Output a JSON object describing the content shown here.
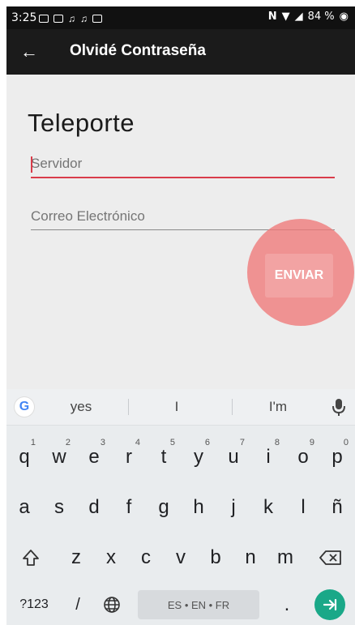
{
  "status": {
    "time": "3:25",
    "battery": "84 %"
  },
  "appbar": {
    "title": "Olvidé Contraseña"
  },
  "content": {
    "brand": "Teleporte",
    "server_placeholder": "Servidor",
    "email_placeholder": "Correo Electrónico",
    "submit_label": "ENVIAR"
  },
  "colors": {
    "accent": "#d93c4a",
    "ripple": "#f07878",
    "enter_key": "#1aa888"
  },
  "keyboard": {
    "suggestions": [
      "yes",
      "I",
      "I'm"
    ],
    "row1": [
      "q",
      "w",
      "e",
      "r",
      "t",
      "y",
      "u",
      "i",
      "o",
      "p"
    ],
    "row1_hints": [
      "1",
      "2",
      "3",
      "4",
      "5",
      "6",
      "7",
      "8",
      "9",
      "0"
    ],
    "row2": [
      "a",
      "s",
      "d",
      "f",
      "g",
      "h",
      "j",
      "k",
      "l",
      "ñ"
    ],
    "row3": [
      "z",
      "x",
      "c",
      "v",
      "b",
      "n",
      "m"
    ],
    "symbols_label": "?123",
    "slash_label": "/",
    "space_label": "ES • EN • FR",
    "period_label": "."
  }
}
